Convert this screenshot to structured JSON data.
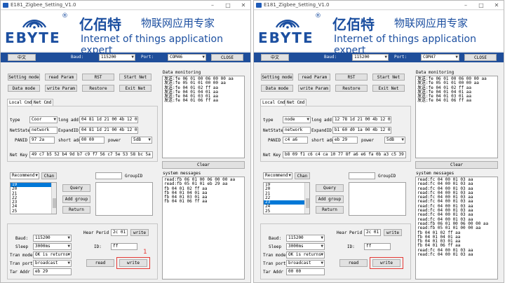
{
  "windows": [
    {
      "title": "E181_Zigbee_Setting_V1.0",
      "brand": {
        "logo_reg": "®",
        "ebyte": "EBYTE",
        "cn_brand": "亿佰特",
        "cn_sub": "物联网应用专家",
        "en_sub": "Internet of things application expert"
      },
      "topbar": {
        "lang_button": "中文",
        "baud_label": "Baud:",
        "baud_value": "115200",
        "port_label": "Port:",
        "port_value": "COM46",
        "close_button": "CLOSE"
      },
      "buttons": {
        "setting_mode": "Setting mode",
        "read_param": "read Param",
        "rst": "RST",
        "start_net": "Start Net",
        "data_mode": "Data mode",
        "write_param": "write Param",
        "restore": "Restore",
        "exit_net": "Exit Net"
      },
      "tabs": [
        "Local Cmd",
        "Net Cmd"
      ],
      "local": {
        "type_label": "type",
        "type_value": "Coor",
        "long_addr_label": "long addr",
        "long_addr_value": "04 81 1d 21 00 4b 12 00",
        "netstate_label": "NetState",
        "netstate_value": "network",
        "expandid_label": "ExpandID",
        "expandid_value": "04 81 1d 21 00 4b 12 00",
        "panid_label": "PANID",
        "panid_value": "97 2a",
        "short_addr_label": "short add",
        "short_addr_value": "00 00",
        "power_label": "power",
        "power_value": "5dB",
        "netkey_label": "Net Key",
        "netkey_value": "49 c7 b5 52 b4 9d b7 c9 f7 56 c7 5e 53 58 bc 5a"
      },
      "group": {
        "recommend": "Recommend",
        "chan_button": "Chan",
        "groupid_label": "GroupID",
        "query": "Query",
        "add_group": "Add group",
        "return": "Return",
        "channels": [
          "19",
          "20",
          "21",
          "22",
          "23",
          "24",
          "25"
        ],
        "selected_index": 0
      },
      "serial": {
        "baud_label": "Baud:",
        "baud_value": "115200",
        "sleep_label": "Sleep",
        "sleep_value": "3000ms",
        "tran_mode_label": "Tran mode",
        "tran_mode_value": "OK is returns",
        "tran_port_label": "Tran port",
        "tran_port_value": "broadcast",
        "tar_addr_label": "Tar Addr",
        "tar_addr_value": "eb 29",
        "hear_perid_label": "Hear Perid",
        "hear_perid_value": "2c 01",
        "hear_write": "write",
        "id_label": "ID:",
        "id_value": "ff",
        "read": "read",
        "write": "write"
      },
      "data_monitoring": {
        "label": "Data monitoring",
        "text": "发送:fe 06 01 00 06 00 00 aa\n发送:fe 05 01 01 00 00 aa\n发送:fe 04 01 02 ff aa\n发送:fe 04 01 04 01 aa\n发送:fe 04 01 03 01 aa\n发送:fe 04 01 06 ff aa",
        "clear": "Clear"
      },
      "system_messages": {
        "label": "system messages",
        "text": "read:fb 06 01 00 06 00 00 aa\nread:fb 05 01 01 eb 29 aa\nfb 04 01 02 ff aa\nfb 04 01 04 01 aa\nfb 04 01 03 01 aa\nfb 04 01 06 ff aa"
      },
      "annotation": "1"
    },
    {
      "title": "E181_Zigbee_Setting_V1.0",
      "brand": {
        "logo_reg": "®",
        "ebyte": "EBYTE",
        "cn_brand": "亿佰特",
        "cn_sub": "物联网应用专家",
        "en_sub": "Internet of things application expert"
      },
      "topbar": {
        "lang_button": "中文",
        "baud_label": "Baud:",
        "baud_value": "115200",
        "port_label": "Port:",
        "port_value": "COM47",
        "close_button": "CLOSE"
      },
      "buttons": {
        "setting_mode": "Setting mode",
        "read_param": "read Param",
        "rst": "RST",
        "start_net": "Start Net",
        "data_mode": "Data mode",
        "write_param": "write Param",
        "restore": "Restore",
        "exit_net": "Exit Net"
      },
      "tabs": [
        "Local Cmd",
        "Net Cmd"
      ],
      "local": {
        "type_label": "type",
        "type_value": "node",
        "long_addr_label": "long addr",
        "long_addr_value": "12 78 1d 21 00 4b 12 00",
        "netstate_label": "NetState",
        "netstate_value": "network",
        "expandid_label": "ExpandID",
        "expandid_value": "b1 60 d0 1a 00 4b 12 00",
        "panid_label": "PANID",
        "panid_value": "c4 a6",
        "short_addr_label": "short add",
        "short_addr_value": "eb 29",
        "power_label": "power",
        "power_value": "5dB",
        "netkey_label": "Net Key",
        "netkey_value": "b8 09 f1 c6 c4 ca 10 77 8f a6 e6 fa 0b a3 c5 39"
      },
      "group": {
        "recommend": "Recommend",
        "chan_button": "Chan",
        "groupid_label": "GroupID",
        "query": "Query",
        "add_group": "Add group",
        "return": "Return",
        "channels": [
          "19",
          "20",
          "21",
          "22",
          "23",
          "24",
          "25"
        ],
        "selected_index": 4
      },
      "serial": {
        "baud_label": "Baud:",
        "baud_value": "115200",
        "sleep_label": "Sleep",
        "sleep_value": "3000ms",
        "tran_mode_label": "Tran mode",
        "tran_mode_value": "OK is returns",
        "tran_port_label": "Tran port",
        "tran_port_value": "broadcast",
        "tar_addr_label": "Tar Addr",
        "tar_addr_value": "00 00",
        "hear_perid_label": "Hear Perid",
        "hear_perid_value": "2c 01",
        "hear_write": "write",
        "id_label": "ID:",
        "id_value": "ff",
        "read": "read",
        "write": "write"
      },
      "data_monitoring": {
        "label": "Data monitoring",
        "text": "发送:fe 06 01 00 06 00 00 aa\n发送:fe 05 01 01 00 00 aa\n发送:fe 04 01 02 ff aa\n发送:fe 04 01 04 01 aa\n发送:fe 04 01 03 01 aa\n发送:fe 04 01 06 ff aa",
        "clear": "Clear"
      },
      "system_messages": {
        "label": "system messages",
        "text": "read:fc 04 00 01 03 aa\nread:fc 04 00 01 03 aa\nread:fc 04 00 01 03 aa\nread:fc 04 00 01 03 aa\nread:fc 04 00 01 03 aa\nread:fc 04 00 01 03 aa\nread:fc 04 00 01 03 aa\nread:fc 04 00 01 03 aa\nread:fc 04 00 01 03 aa\nread:fc 04 00 01 03 aa\nread:fb 06 01 00 06 00 00 aa\nread:fb 05 01 01 00 00 aa\nfb 04 01 02 ff aa\nfb 04 01 04 01 aa\nfb 04 01 03 01 aa\nfb 04 01 06 ff aa\nread:fc 04 00 01 03 aa\nread:fc 04 00 01 03 aa"
      },
      "annotation": ""
    }
  ],
  "colors": {
    "brand_blue": "#1c4fa0",
    "topbar_blue": "#1f4e9a",
    "highlight": "#0078d7",
    "annotation_red": "#e53935"
  }
}
